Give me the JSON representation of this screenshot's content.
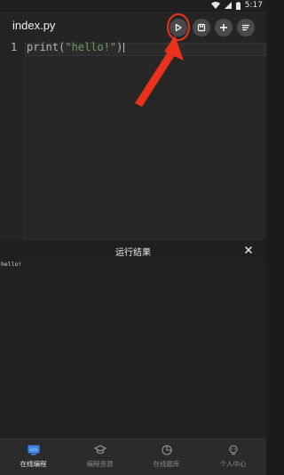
{
  "status_bar": {
    "time": "5:17"
  },
  "app_bar": {
    "file_name": "index.py",
    "buttons": [
      {
        "name": "run",
        "icon": "play-icon"
      },
      {
        "name": "save",
        "icon": "save-icon"
      },
      {
        "name": "add",
        "icon": "plus-icon"
      },
      {
        "name": "menu",
        "icon": "menu-icon"
      }
    ]
  },
  "editor": {
    "line_number": "1",
    "code_prefix": "print(",
    "code_string": "\"hello!\"",
    "code_suffix": ")"
  },
  "result_panel": {
    "title": "运行结果",
    "output": "hello!"
  },
  "bottom_nav": {
    "items": [
      {
        "label": "在线编程",
        "icon": "code-screen-icon",
        "active": true
      },
      {
        "label": "编程资源",
        "icon": "graduation-cap-icon",
        "active": false
      },
      {
        "label": "在线题库",
        "icon": "pie-chart-icon",
        "active": false
      },
      {
        "label": "个人中心",
        "icon": "profile-icon",
        "active": false
      }
    ]
  },
  "colors": {
    "accent_blue": "#3d86e6",
    "annotation_red": "#e8321c",
    "string_green": "#6e9f5e"
  }
}
